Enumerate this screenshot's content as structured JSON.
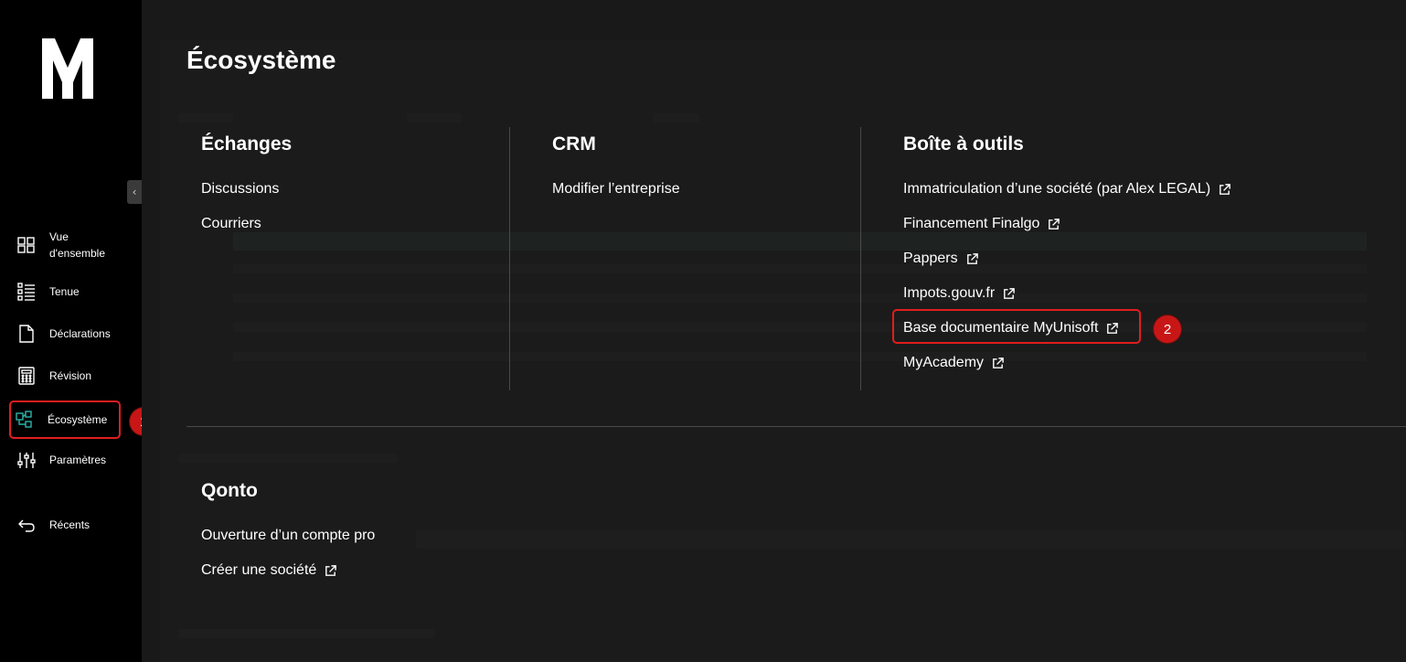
{
  "sidebar": {
    "collapse_glyph": "‹",
    "items": [
      {
        "label": "Vue d'ensemble",
        "icon": "grid-icon"
      },
      {
        "label": "Tenue",
        "icon": "list-icon"
      },
      {
        "label": "Déclarations",
        "icon": "document-icon"
      },
      {
        "label": "Révision",
        "icon": "calculator-icon"
      },
      {
        "label": "Écosystème",
        "icon": "ecosystem-icon"
      },
      {
        "label": "Paramètres",
        "icon": "sliders-icon"
      },
      {
        "label": "Récents",
        "icon": "back-arrow-icon"
      }
    ]
  },
  "steps": {
    "one": "1",
    "two": "2"
  },
  "panel": {
    "title": "Écosystème",
    "echanges": {
      "title": "Échanges",
      "links": [
        "Discussions",
        "Courriers"
      ]
    },
    "crm": {
      "title": "CRM",
      "links": [
        "Modifier l’entreprise"
      ]
    },
    "boite": {
      "title": "Boîte à outils",
      "links": [
        "Immatriculation d’une société (par Alex LEGAL)",
        "Financement Finalgo",
        "Pappers",
        "Impots.gouv.fr",
        "Base documentaire MyUnisoft",
        "MyAcademy"
      ]
    },
    "qonto": {
      "title": "Qonto",
      "links": [
        "Ouverture d’un compte pro",
        "Créer une société"
      ]
    }
  },
  "colors": {
    "accent": "#e01e1e",
    "badge": "#c81616",
    "icon_accent": "#2bb3a8"
  }
}
